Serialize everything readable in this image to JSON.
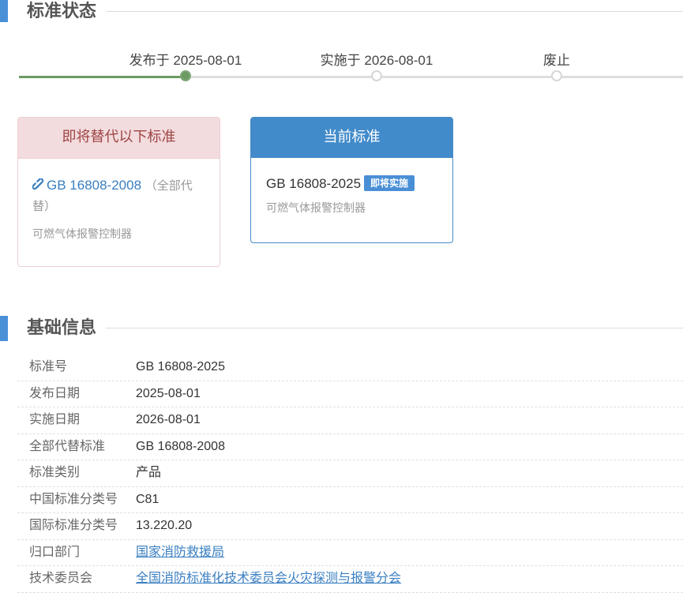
{
  "status_section": {
    "title": "标准状态",
    "timeline": [
      {
        "label": "发布于 2025-08-01",
        "done": true
      },
      {
        "label": "实施于 2026-08-01",
        "done": false
      },
      {
        "label": "废止",
        "done": false
      }
    ]
  },
  "replace_card": {
    "header": "即将替代以下标准",
    "link_code": "GB 16808-2008",
    "note": "（全部代替）",
    "note_line1": "（全部代",
    "note_line2": "替）",
    "name": "可燃气体报警控制器",
    "icon": "link-icon"
  },
  "current_card": {
    "header": "当前标准",
    "code": "GB 16808-2025",
    "badge": "即将实施",
    "name": "可燃气体报警控制器"
  },
  "basic_section": {
    "title": "基础信息",
    "rows": [
      {
        "key": "标准号",
        "value": "GB 16808-2025"
      },
      {
        "key": "发布日期",
        "value": "2025-08-01"
      },
      {
        "key": "实施日期",
        "value": "2026-08-01"
      },
      {
        "key": "全部代替标准",
        "value": "GB 16808-2008"
      },
      {
        "key": "标准类别",
        "value": "产品"
      },
      {
        "key": "中国标准分类号",
        "value": "C81"
      },
      {
        "key": "国际标准分类号",
        "value": "13.220.20"
      },
      {
        "key": "归口部门",
        "value": "国家消防救援局"
      },
      {
        "key": "技术委员会",
        "value": "全国消防标准化技术委员会火灾探测与报警分会"
      }
    ]
  },
  "colors": {
    "accent": "#4a90d9",
    "timeline_done": "#6b9a63",
    "replace_header_bg": "#f2dcde",
    "replace_header_text": "#a04545",
    "current_header_bg": "#428bca",
    "link": "#3a7fc1"
  }
}
